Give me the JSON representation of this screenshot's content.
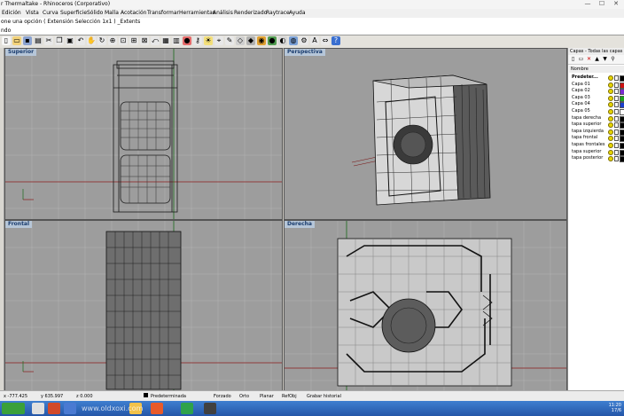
{
  "window": {
    "title": "r Thermaltake - Rhinoceros (Corporativo)"
  },
  "menu": [
    "Edición",
    "Vista",
    "Curva",
    "Superficie",
    "Sólido",
    "Malla",
    "Acotación",
    "Transformar",
    "Herramientas",
    "Análisis",
    "Renderizado",
    "Raytrace",
    "Ayuda"
  ],
  "command": {
    "history": "one una opción ( Extensión  Selección  1x1 ) _Extents",
    "prompt_label": "ndo",
    "value": ""
  },
  "viewports": [
    {
      "title": "Superior"
    },
    {
      "title": "Perspectiva"
    },
    {
      "title": "Frontal"
    },
    {
      "title": "Derecha"
    }
  ],
  "layers_panel": {
    "title": "Capas - Todas las capas",
    "column_header": "Nombre",
    "items": [
      {
        "name": "Predeter...",
        "color": "#000000"
      },
      {
        "name": "Capa 01",
        "color": "#cc1010"
      },
      {
        "name": "Capa 02",
        "color": "#7a2bd0"
      },
      {
        "name": "Capa 03",
        "color": "#1ba21b"
      },
      {
        "name": "Capa 04",
        "color": "#1c3fcc"
      },
      {
        "name": "Capa 05",
        "color": "#ffffff"
      },
      {
        "name": "tapa derecha",
        "color": "#000000"
      },
      {
        "name": "tapa superior",
        "color": "#000000"
      },
      {
        "name": "tapa izquierda",
        "color": "#000000"
      },
      {
        "name": "tapa frontal",
        "color": "#000000"
      },
      {
        "name": "tapas frontales",
        "color": "#000000"
      },
      {
        "name": "tapa superior",
        "color": "#000000"
      },
      {
        "name": "tapa posterior",
        "color": "#000000"
      }
    ]
  },
  "status": {
    "x": "x -777.425",
    "y": "y 635.997",
    "z": "z 0.000",
    "layer": "Predeterminada",
    "forzado": "Forzado",
    "orto": "Orto",
    "planar": "Planar",
    "refobj": "RefObj",
    "grabar": "Grabar historial"
  },
  "taskbar": {
    "clock": "11:20\n17/6"
  },
  "watermark": "www.oldxoxi.com"
}
